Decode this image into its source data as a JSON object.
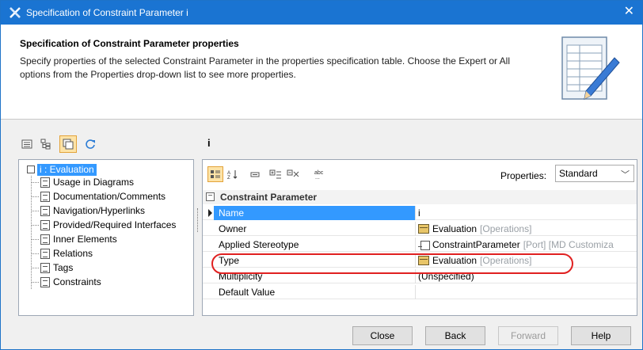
{
  "window": {
    "title": "Specification of Constraint Parameter i",
    "close_glyph": "✕",
    "icon": "magicdraw-x-icon"
  },
  "header": {
    "title": "Specification of Constraint Parameter properties",
    "description": "Specify properties of the selected Constraint Parameter in the properties specification table. Choose the Expert or All options from the Properties drop-down list to see more properties."
  },
  "left_toolbar": {
    "buttons": [
      "list-view-icon",
      "tree-view-icon",
      "filter-icon",
      "refresh-icon"
    ]
  },
  "selected_node_name": "i",
  "tree": {
    "root": "i : Evaluation",
    "items": [
      "Usage in Diagrams",
      "Documentation/Comments",
      "Navigation/Hyperlinks",
      "Provided/Required Interfaces",
      "Inner Elements",
      "Relations",
      "Tags",
      "Constraints"
    ]
  },
  "right_toolbar": {
    "buttons": [
      "categorized-icon",
      "sort-alpha-icon",
      "collapse-icon",
      "expand-all-icon",
      "collapse-all-icon",
      "abc-icon"
    ],
    "properties_label": "Properties:",
    "properties_value": "Standard"
  },
  "grid": {
    "group": "Constraint Parameter",
    "rows": [
      {
        "name": "Name",
        "value": "i",
        "suffix": "",
        "icon": ""
      },
      {
        "name": "Owner",
        "value": "Evaluation",
        "suffix": "[Operations]",
        "icon": "class-icon"
      },
      {
        "name": "Applied Stereotype",
        "value": "ConstraintParameter",
        "suffix": "[Port] [MD Customiza",
        "icon": "port-icon"
      },
      {
        "name": "Type",
        "value": "Evaluation",
        "suffix": "[Operations]",
        "icon": "class-icon"
      },
      {
        "name": "Multiplicity",
        "value": "(Unspecified)",
        "suffix": "",
        "icon": ""
      },
      {
        "name": "Default Value",
        "value": "",
        "suffix": "",
        "icon": ""
      }
    ]
  },
  "buttons": {
    "close": "Close",
    "back": "Back",
    "forward": "Forward",
    "help": "Help"
  },
  "colors": {
    "title_bar": "#1a74d2",
    "selection": "#3399ff",
    "highlight_oval": "#e02020",
    "active_tool": "#fde3a7"
  }
}
